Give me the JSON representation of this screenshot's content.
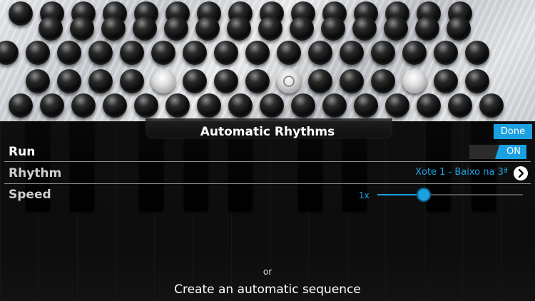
{
  "dialog": {
    "title": "Automatic Rhythms",
    "done_label": "Done"
  },
  "run": {
    "label": "Run",
    "toggle_label": "ON",
    "state": true
  },
  "rhythm": {
    "label": "Rhythm",
    "value": "Xote 1 - Baixo na 3ª"
  },
  "speed": {
    "label": "Speed",
    "value_text": "1x",
    "slider_fraction": 0.32
  },
  "footer": {
    "or_label": "or",
    "create_label": "Create an automatic sequence"
  },
  "colors": {
    "accent": "#1ba1e2",
    "background": "#000000"
  },
  "icons": {
    "rhythm_chevron": "chevron-right-icon"
  }
}
